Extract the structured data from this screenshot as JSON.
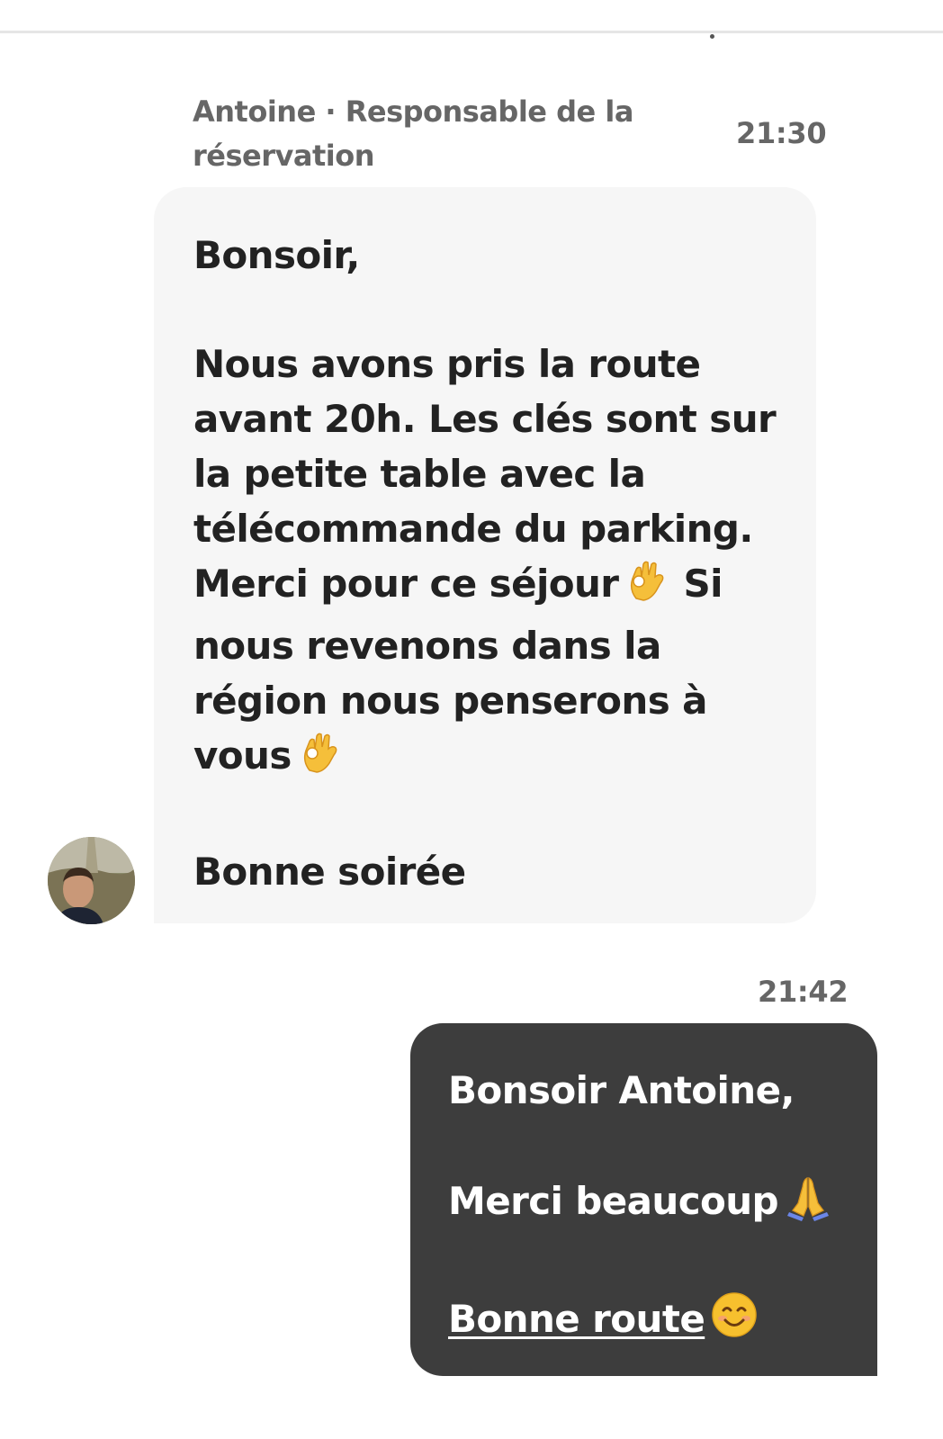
{
  "thread": {
    "received": {
      "sender_line": "Antoine · Responsable de la réservation",
      "time": "21:30",
      "greeting": "Bonsoir,",
      "body_part1": "Nous avons pris la route avant 20h. Les clés sont sur la petite table avec la télécommande du parking. Merci pour ce séjour",
      "body_part2": "Si nous revenons dans la région nous penserons à vous",
      "closing": "Bonne soirée",
      "emoji_1": "ok-hand-emoji",
      "emoji_2": "ok-hand-emoji"
    },
    "sent": {
      "time": "21:42",
      "greeting": "Bonsoir Antoine,",
      "thanks": "Merci beaucoup",
      "thanks_emoji": "folded-hands-emoji",
      "farewell_link": "Bonne route",
      "farewell_emoji": "smiling-face-emoji"
    }
  },
  "colors": {
    "received_bubble": "#f6f6f6",
    "sent_bubble": "#3d3d3d",
    "meta_text": "#666666",
    "body_text": "#222222"
  }
}
